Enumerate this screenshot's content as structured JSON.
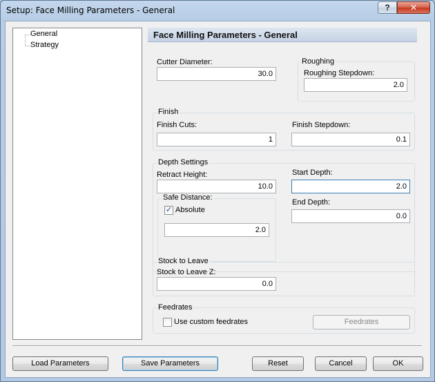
{
  "window": {
    "title": "Setup: Face Milling Parameters - General",
    "help_label": "?",
    "close_label": "✕"
  },
  "tree": {
    "items": [
      {
        "label": "General"
      },
      {
        "label": "Strategy"
      }
    ]
  },
  "panel": {
    "title": "Face Milling Parameters - General",
    "cutter_diameter": {
      "label": "Cutter Diameter:",
      "value": "30.0"
    },
    "roughing": {
      "group_label": "Roughing",
      "stepdown": {
        "label": "Roughing Stepdown:",
        "value": "2.0"
      }
    },
    "finish": {
      "group_label": "Finish",
      "cuts": {
        "label": "Finish Cuts:",
        "value": "1"
      },
      "stepdown": {
        "label": "Finish Stepdown:",
        "value": "0.1"
      }
    },
    "depth": {
      "group_label": "Depth Settings",
      "retract_height": {
        "label": "Retract Height:",
        "value": "10.0"
      },
      "start_depth": {
        "label": "Start Depth:",
        "value": "2.0"
      },
      "safe_distance": {
        "group_label": "Safe Distance:",
        "absolute_label": "Absolute",
        "absolute_checked": true,
        "value": "2.0"
      },
      "end_depth": {
        "label": "End Depth:",
        "value": "0.0"
      }
    },
    "stock": {
      "group_label": "Stock to Leave",
      "z": {
        "label": "Stock to Leave Z:",
        "value": "0.0"
      }
    },
    "feedrates": {
      "group_label": "Feedrates",
      "custom_label": "Use custom feedrates",
      "custom_checked": false,
      "button_label": "Feedrates"
    }
  },
  "buttons": {
    "load": "Load Parameters",
    "save": "Save Parameters",
    "reset": "Reset",
    "cancel": "Cancel",
    "ok": "OK"
  },
  "colors": {
    "accent_border": "#3c7fb1",
    "header_bar": "#c6d3e4",
    "close_button": "#c5391e"
  }
}
